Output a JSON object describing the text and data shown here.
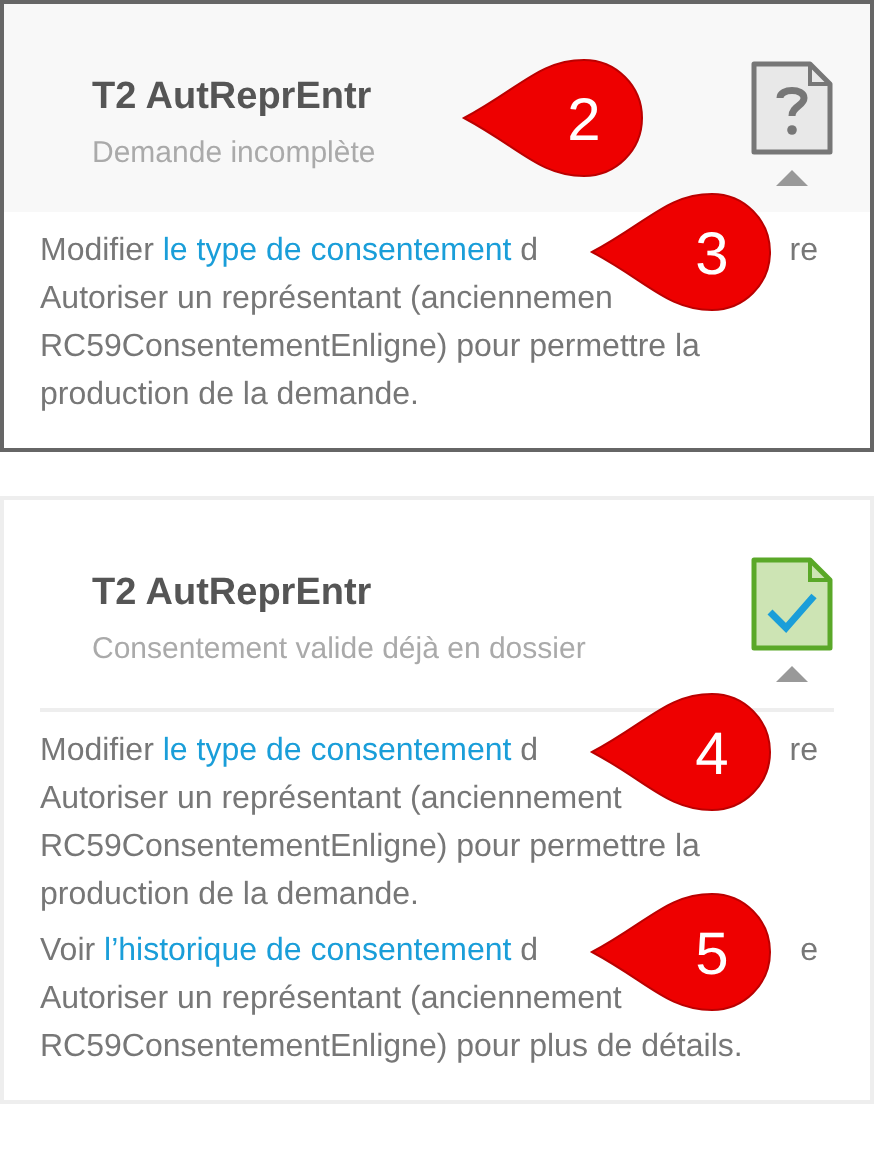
{
  "cards": [
    {
      "selected": true,
      "kind": "incomplete",
      "expanded": true,
      "title": "T2 AutReprEntr",
      "subtitle": "Demande incomplète",
      "callout": "2",
      "paragraphs": [
        {
          "lines": [
            {
              "before": "Modifier ",
              "link": "le type de consentement",
              "after": " d",
              "end": "re",
              "callout": "3"
            },
            {
              "before": "Autoriser un représentant (anciennemen"
            },
            {
              "before": "RC59ConsentementEnligne) pour permettre la"
            },
            {
              "before": "production de la demande."
            }
          ]
        }
      ]
    },
    {
      "selected": false,
      "kind": "valid",
      "expanded": true,
      "title": "T2 AutReprEntr",
      "subtitle": "Consentement valide déjà en dossier",
      "paragraphs": [
        {
          "lines": [
            {
              "before": "Modifier ",
              "link": "le type de consentement",
              "after": " d",
              "end": "re",
              "callout": "4"
            },
            {
              "before": "Autoriser un représentant (anciennement"
            },
            {
              "before": "RC59ConsentementEnligne) pour permettre la"
            },
            {
              "before": "production de la demande."
            }
          ]
        },
        {
          "lines": [
            {
              "before": "Voir ",
              "link": "l’historique de consentement",
              "after": " d",
              "end": "e",
              "callout": "5"
            },
            {
              "before": "Autoriser un représentant (anciennement"
            },
            {
              "before": "RC59ConsentementEnligne) pour plus de détails."
            }
          ]
        }
      ]
    }
  ]
}
